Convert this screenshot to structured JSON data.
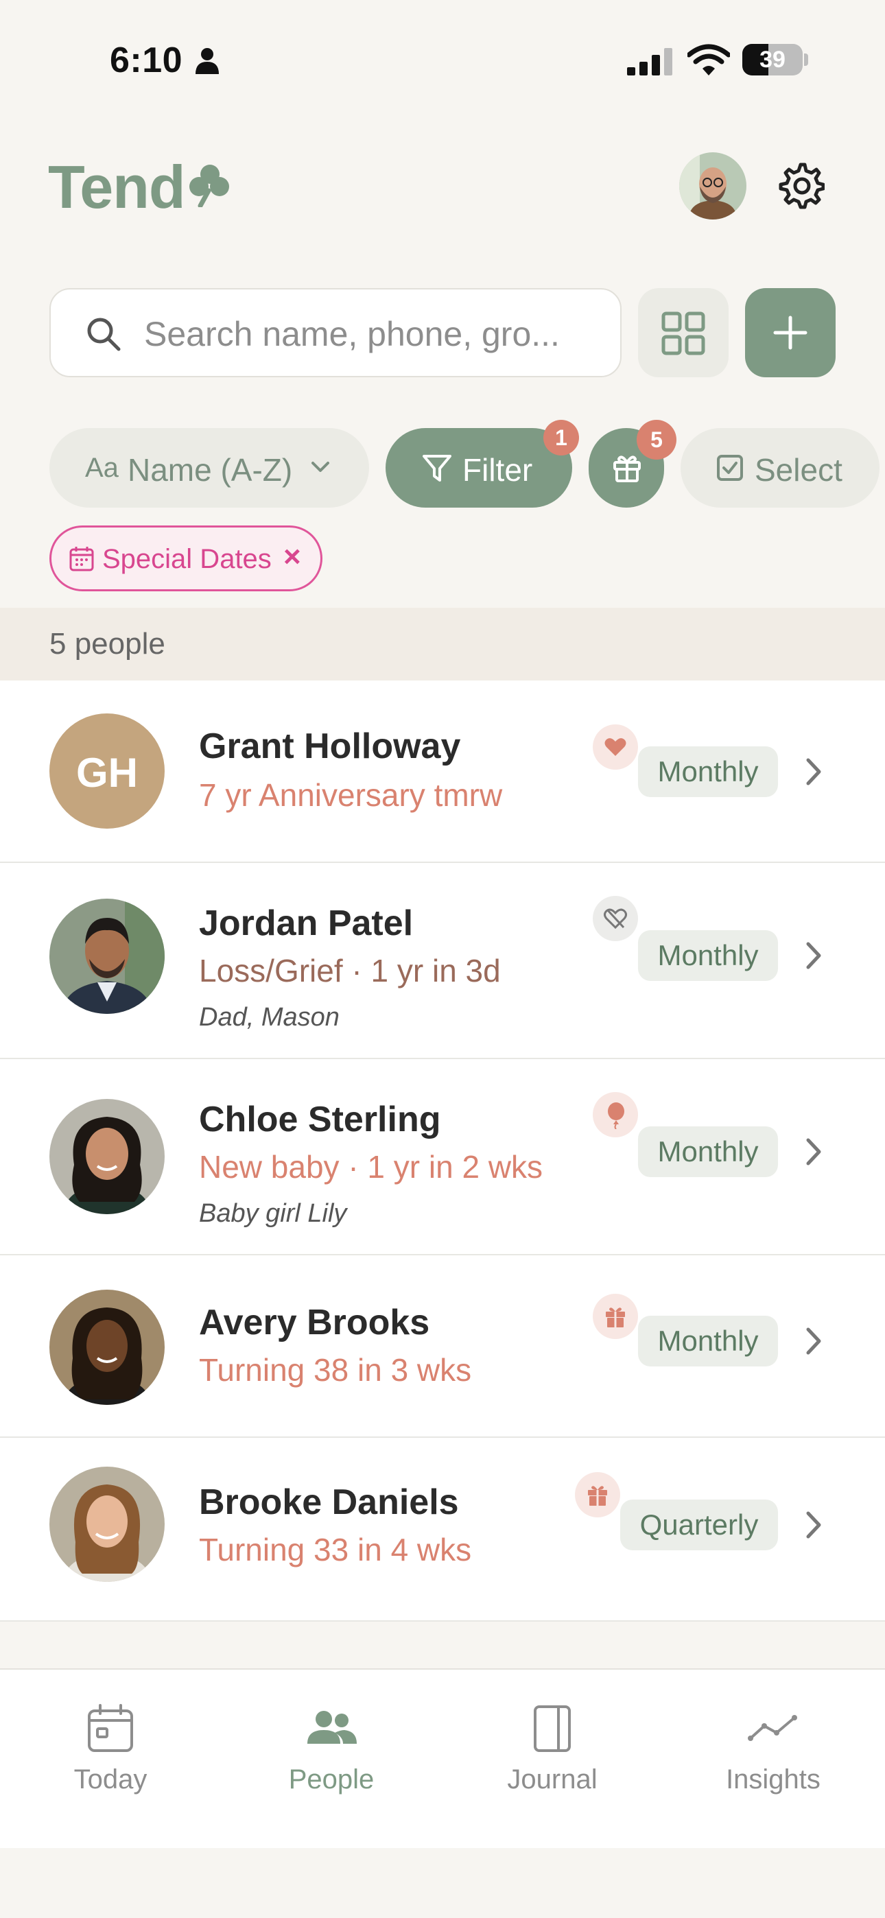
{
  "status_bar": {
    "time": "6:10",
    "battery": "39"
  },
  "header": {
    "logo": "Tend"
  },
  "search": {
    "placeholder": "Search name, phone, gro..."
  },
  "toolbar": {
    "sort_icon": "Aa",
    "sort_label": "Name (A-Z)",
    "filter_label": "Filter",
    "filter_badge": "1",
    "gift_badge": "5",
    "select_label": "Select"
  },
  "active_tag": {
    "label": "Special Dates",
    "remove": "×"
  },
  "summary": {
    "count_label": "5 people"
  },
  "people": [
    {
      "initials": "GH",
      "name": "Grant Holloway",
      "subtitle": "7 yr Anniversary tmrw",
      "note": "",
      "icon": "heart-icon",
      "frequency": "Monthly"
    },
    {
      "initials": "",
      "name": "Jordan Patel",
      "subtitle": "Loss/Grief · 1 yr in 3d",
      "note": "Dad, Mason",
      "icon": "broken-heart-icon",
      "frequency": "Monthly"
    },
    {
      "initials": "",
      "name": "Chloe Sterling",
      "subtitle": "New baby · 1 yr in 2 wks",
      "note": "Baby girl Lily",
      "icon": "balloon-icon",
      "frequency": "Monthly"
    },
    {
      "initials": "",
      "name": "Avery Brooks",
      "subtitle": "Turning 38 in 3 wks",
      "note": "",
      "icon": "gift-icon",
      "frequency": "Monthly"
    },
    {
      "initials": "",
      "name": "Brooke Daniels",
      "subtitle": "Turning 33 in 4 wks",
      "note": "",
      "icon": "gift-icon",
      "frequency": "Quarterly"
    }
  ],
  "tabs": [
    {
      "label": "Today",
      "icon": "calendar-icon",
      "active": false
    },
    {
      "label": "People",
      "icon": "people-icon",
      "active": true
    },
    {
      "label": "Journal",
      "icon": "journal-icon",
      "active": false
    },
    {
      "label": "Insights",
      "icon": "insights-icon",
      "active": false
    }
  ],
  "colors": {
    "accent": "#7e9a84",
    "coral": "#d9826f",
    "pink": "#d8468f",
    "background": "#f7f5f1"
  }
}
